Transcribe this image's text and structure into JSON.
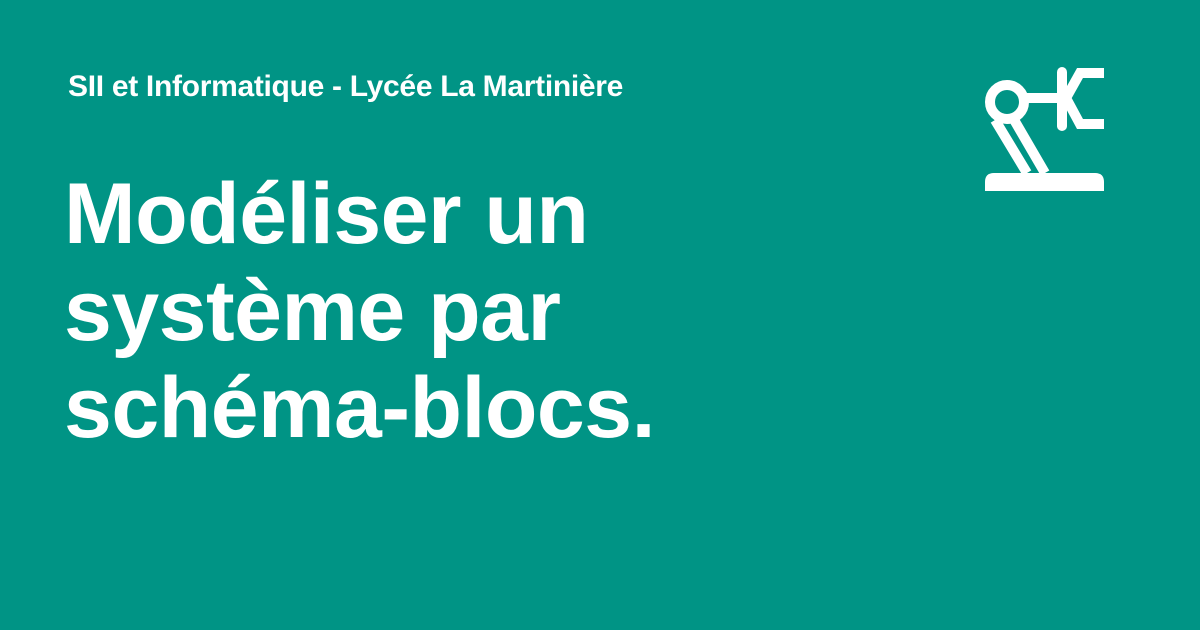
{
  "site_name": "SII et Informatique - Lycée La Martinière",
  "page_title_lines": [
    "Modéliser un",
    "système par",
    "schéma-blocs."
  ],
  "logo_icon": "robot-industrial-outline-icon",
  "colors": {
    "background": "#009485",
    "text": "#ffffff"
  }
}
